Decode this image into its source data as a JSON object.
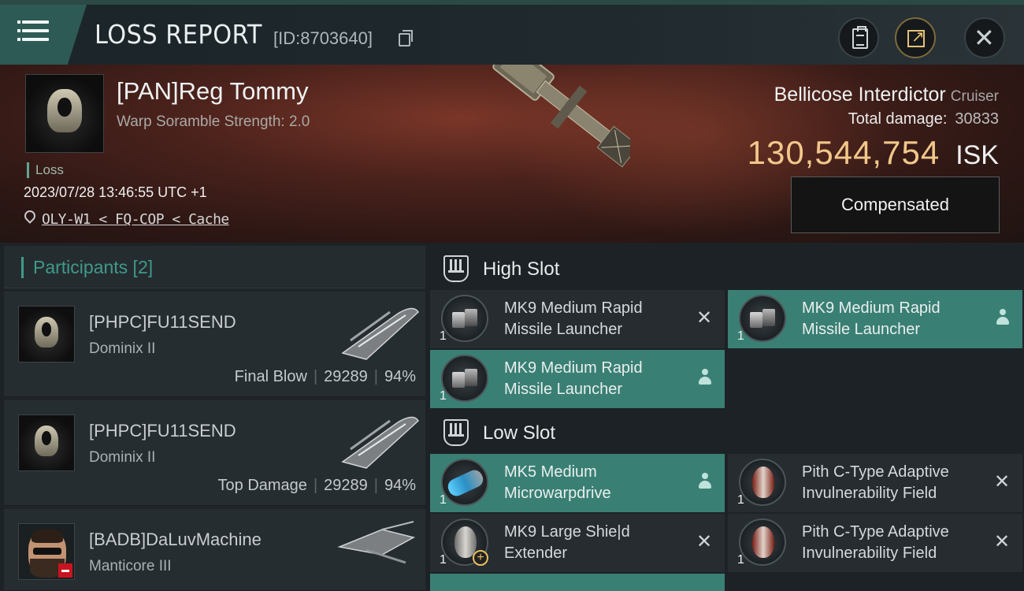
{
  "header": {
    "title": "LOSS REPORT",
    "report_id": "[ID:8703640]"
  },
  "victim": {
    "name": "[PAN]Reg Tommy",
    "subtitle": "Warp Soramble Strength: 2.0",
    "tag": "Loss",
    "timestamp": "2023/07/28 13:46:55 UTC +1",
    "location": "OLY-W1 < FQ-COP < Cache",
    "ship_name": "Bellicose Interdictor",
    "ship_class": "Cruiser",
    "total_damage_label": "Total damage:",
    "total_damage": "30833",
    "isk_value": "130,544,754",
    "isk_currency": "ISK",
    "compensated_label": "Compensated"
  },
  "participants": {
    "heading": "Participants [2]",
    "list": [
      {
        "name": "[PHPC]FU11SEND",
        "ship": "Dominix II",
        "role": "Final Blow",
        "damage": "29289",
        "percent": "94%"
      },
      {
        "name": "[PHPC]FU11SEND",
        "ship": "Dominix II",
        "role": "Top Damage",
        "damage": "29289",
        "percent": "94%"
      },
      {
        "name": "[BADB]DaLuvMachine",
        "ship": "Manticore III"
      }
    ]
  },
  "fitting": {
    "high_slot_label": "High Slot",
    "low_slot_label": "Low Slot",
    "high": [
      {
        "line1": "MK9 Medium Rapid",
        "line2": "Missile Launcher",
        "qty": "1",
        "status": "destroyed",
        "icon": "launcher-icon"
      },
      {
        "line1": "MK9 Medium Rapid",
        "line2": "Missile Launcher",
        "qty": "1",
        "status": "dropped",
        "icon": "launcher-icon"
      },
      {
        "line1": "MK9 Medium Rapid",
        "line2": "Missile Launcher",
        "qty": "1",
        "status": "dropped",
        "icon": "launcher-icon"
      }
    ],
    "low": [
      {
        "line1": "MK5 Medium",
        "line2": "Microwarpdrive",
        "qty": "1",
        "status": "dropped",
        "icon": "microwarpdrive-icon"
      },
      {
        "line1": "Pith C-Type Adaptive",
        "line2": "Invulnerability Field",
        "qty": "1",
        "status": "destroyed",
        "icon": "invulnerability-field-icon"
      },
      {
        "line1": "MK9 Large Shie|d",
        "line2": "Extender",
        "qty": "1",
        "status": "destroyed",
        "icon": "shield-extender-icon"
      },
      {
        "line1": "Pith C-Type Adaptive",
        "line2": "Invulnerability Field",
        "qty": "1",
        "status": "destroyed",
        "icon": "invulnerability-field-icon"
      }
    ],
    "destroyed_glyph": "✕"
  },
  "colors": {
    "accent_teal": "#3f9a8a",
    "dropped_bg": "#3a7f74",
    "isk_gold": "#f2c78a",
    "banner_red": "#7a3628"
  }
}
